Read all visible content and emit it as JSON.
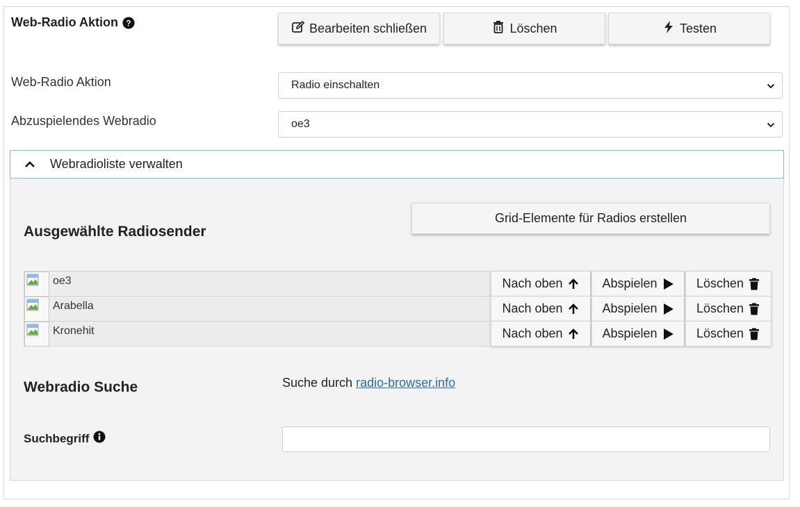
{
  "header": {
    "title": "Web-Radio Aktion",
    "buttons": {
      "edit_close": "Bearbeiten schließen",
      "delete": "Löschen",
      "test": "Testen"
    }
  },
  "fields": {
    "action_label": "Web-Radio Aktion",
    "action_value": "Radio einschalten",
    "station_label": "Abzuspielendes Webradio",
    "station_value": "oe3"
  },
  "accordion": {
    "title": "Webradioliste verwalten",
    "selected_heading": "Ausgewählte Radiosender",
    "grid_button": "Grid-Elemente für Radios erstellen",
    "stations": [
      {
        "name": "oe3",
        "up": "Nach oben",
        "play": "Abspielen",
        "delete": "Löschen"
      },
      {
        "name": "Arabella",
        "up": "Nach oben",
        "play": "Abspielen",
        "delete": "Löschen"
      },
      {
        "name": "Kronehit",
        "up": "Nach oben",
        "play": "Abspielen",
        "delete": "Löschen"
      }
    ],
    "search_heading": "Webradio Suche",
    "search_text": "Suche durch",
    "search_link": "radio-browser.info",
    "search_term_label": "Suchbegriff",
    "search_value": ""
  },
  "icons": {
    "help": "question-circle-icon",
    "edit": "edit-icon",
    "trash": "trash-icon",
    "bolt": "bolt-icon",
    "chevron_up": "chevron-up-icon",
    "chevron_down": "chevron-down-icon",
    "arrow_up": "arrow-up-icon",
    "play": "play-icon",
    "info": "info-circle-icon"
  },
  "colors": {
    "accent_border": "#7fb8d8",
    "link": "#2a6db0"
  }
}
